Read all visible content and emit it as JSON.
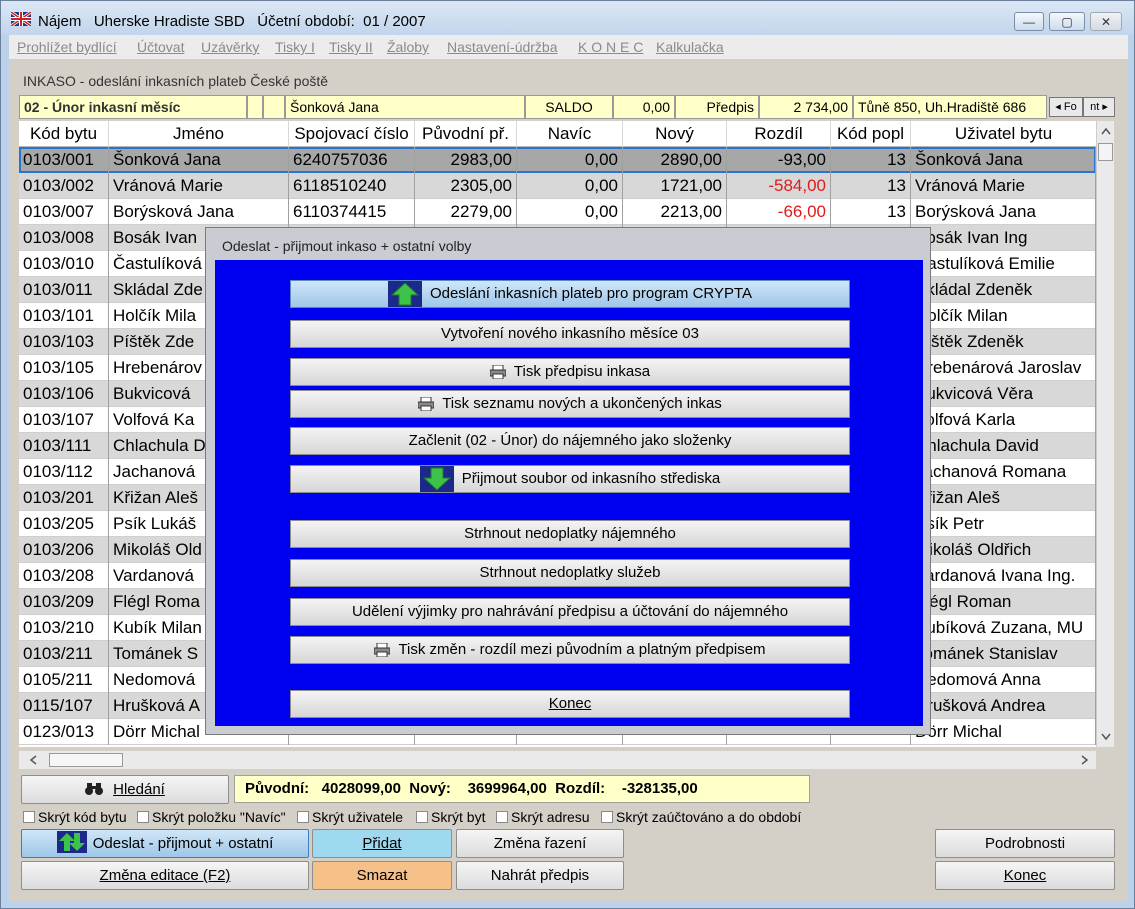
{
  "window": {
    "title": "Nájem   Uherske Hradiste SBD   Účetní období:  01 / 2007",
    "buttons": {
      "minimize": "—",
      "maximize": "▢",
      "close": "✕"
    }
  },
  "menu": [
    "Prohlížet bydlící",
    "Účtovat",
    "Uzávěrky",
    "Tisky I",
    "Tisky II",
    "Žaloby",
    "Nastavení-údržba",
    "K O N E C",
    "Kalkulačka"
  ],
  "subtitle": "INKASO - odeslání inkasních plateb České poště",
  "infobar": {
    "month": "02 - Únor inkasní měsíc",
    "name": "Šonková Jana",
    "saldo_label": "SALDO",
    "saldo_value": "0,00",
    "predpis_label": "Předpis",
    "predpis_value": "2 734,00",
    "address": "Tůně 850, Uh.Hradiště 686",
    "nav_prev": "◂ Fo",
    "nav_next": "nt ▸"
  },
  "table": {
    "columns": [
      "Kód bytu",
      "Jméno",
      "Spojovací číslo",
      "Původní př.",
      "Navíc",
      "Nový",
      "Rozdíl",
      "Kód popl",
      "Uživatel bytu"
    ],
    "rows": [
      [
        "0103/001",
        "Šonková Jana",
        "6240757036",
        "2983,00",
        "0,00",
        "2890,00",
        "-93,00",
        "13",
        "Šonková Jana"
      ],
      [
        "0103/002",
        "Vránová Marie",
        "6118510240",
        "2305,00",
        "0,00",
        "1721,00",
        "-584,00",
        "13",
        "Vránová Marie"
      ],
      [
        "0103/007",
        "Borýsková Jana",
        "6110374415",
        "2279,00",
        "0,00",
        "2213,00",
        "-66,00",
        "13",
        "Borýsková Jana"
      ],
      [
        "0103/008",
        "Bosák Ivan",
        "",
        "",
        "",
        "",
        "",
        "",
        "Bosák Ivan Ing"
      ],
      [
        "0103/010",
        "Častulíková",
        "",
        "",
        "",
        "",
        "",
        "",
        "Častulíková Emilie"
      ],
      [
        "0103/011",
        "Skládal Zde",
        "",
        "",
        "",
        "",
        "",
        "",
        "Skládal Zdeněk"
      ],
      [
        "0103/101",
        "Holčík Mila",
        "",
        "",
        "",
        "",
        "",
        "",
        "Holčík Milan"
      ],
      [
        "0103/103",
        "Píštěk Zde",
        "",
        "",
        "",
        "",
        "",
        "",
        "Píštěk Zdeněk"
      ],
      [
        "0103/105",
        "Hrebenárov",
        "",
        "",
        "",
        "",
        "",
        "",
        "Hrebenárová Jaroslav"
      ],
      [
        "0103/106",
        "Bukvicová",
        "",
        "",
        "",
        "",
        "",
        "",
        "Bukvicová Věra"
      ],
      [
        "0103/107",
        "Volfová Ka",
        "",
        "",
        "",
        "",
        "",
        "",
        "Volfová Karla"
      ],
      [
        "0103/111",
        "Chlachula D",
        "",
        "",
        "",
        "",
        "",
        "",
        "Chlachula David"
      ],
      [
        "0103/112",
        "Jachanová",
        "",
        "",
        "",
        "",
        "",
        "",
        "Jachanová Romana"
      ],
      [
        "0103/201",
        "Křižan Aleš",
        "",
        "",
        "",
        "",
        "",
        "",
        "Křižan Aleš"
      ],
      [
        "0103/205",
        "Psík Lukáš",
        "",
        "",
        "",
        "",
        "",
        "",
        "Psík Petr"
      ],
      [
        "0103/206",
        "Mikoláš Old",
        "",
        "",
        "",
        "",
        "",
        "",
        "Mikoláš Oldřich"
      ],
      [
        "0103/208",
        "Vardanová",
        "",
        "",
        "",
        "",
        "",
        "",
        "Vardanová Ivana Ing."
      ],
      [
        "0103/209",
        "Flégl Roma",
        "",
        "",
        "",
        "",
        "",
        "",
        "Flégl Roman"
      ],
      [
        "0103/210",
        "Kubík Milan",
        "",
        "",
        "",
        "",
        "",
        "",
        "Kubíková Zuzana, MU"
      ],
      [
        "0103/211",
        "Tománek S",
        "",
        "",
        "",
        "",
        "",
        "",
        "Tománek Stanislav"
      ],
      [
        "0105/211",
        "Nedomová",
        "",
        "",
        "",
        "",
        "",
        "",
        "Nedomová Anna"
      ],
      [
        "0115/107",
        "Hrušková A",
        "",
        "",
        "",
        "",
        "",
        "",
        "Hrušková Andrea"
      ],
      [
        "0123/013",
        "Dörr Michal",
        "",
        "",
        "",
        "",
        "",
        "",
        "Dörr Michal"
      ]
    ],
    "row_colors": [
      "selected",
      "alt",
      "white",
      "alt",
      "white",
      "alt",
      "white",
      "alt",
      "white",
      "alt",
      "white",
      "alt",
      "white",
      "alt",
      "white",
      "alt",
      "white",
      "alt",
      "white",
      "alt",
      "white",
      "alt",
      "white"
    ]
  },
  "dialog": {
    "title": "Odeslat - přijmout inkaso + ostatní volby",
    "buttons": [
      {
        "label": "Odeslání inkasních plateb pro program CRYPTA",
        "icon": "arrow-up-icon"
      },
      {
        "label": "Vytvoření nového inkasního měsíce 03",
        "icon": ""
      },
      {
        "label": "Tisk předpisu inkasa",
        "icon": "printer-icon"
      },
      {
        "label": "Tisk seznamu nových a ukončených inkas",
        "icon": "printer-icon"
      },
      {
        "label": "Začlenit (02 - Únor) do nájemného jako složenky",
        "icon": ""
      },
      {
        "label": "Přijmout soubor od inkasního střediska",
        "icon": "arrow-down-icon"
      },
      {
        "label": "Strhnout nedoplatky nájemného",
        "icon": ""
      },
      {
        "label": "Strhnout nedoplatky služeb",
        "icon": ""
      },
      {
        "label": "Udělení výjimky pro nahrávání předpisu a účtování do nájemného",
        "icon": ""
      },
      {
        "label": "Tisk změn - rozdíl mezi původním a platným předpisem",
        "icon": "printer-icon"
      },
      {
        "label": "Konec",
        "icon": ""
      }
    ]
  },
  "search_button": "Hledání",
  "summary": "Původní:   4028099,00  Nový:    3699964,00  Rozdíl:    -328135,00",
  "checkboxes": [
    "Skrýt kód bytu",
    "Skrýt položku \"Navíc\"",
    "Skrýt uživatele",
    "Skrýt byt",
    "Skrýt adresu",
    "Skrýt zaúčtováno a do období"
  ],
  "bottom_buttons": {
    "send": "Odeslat - přijmout + ostatní",
    "add": "Přidat",
    "sort": "Změna řazení",
    "details": "Podrobnosti",
    "edit_mode": "Změna editace (F2)",
    "delete": "Smazat",
    "load": "Nahrát předpis",
    "exit": "Konec"
  },
  "colors": {
    "dialog_body": "#0000f0",
    "negative": "#e21a1a",
    "highlight_yellow": "#ffffc8",
    "add_button": "#9fd9ef",
    "delete_button": "#f6c089"
  }
}
